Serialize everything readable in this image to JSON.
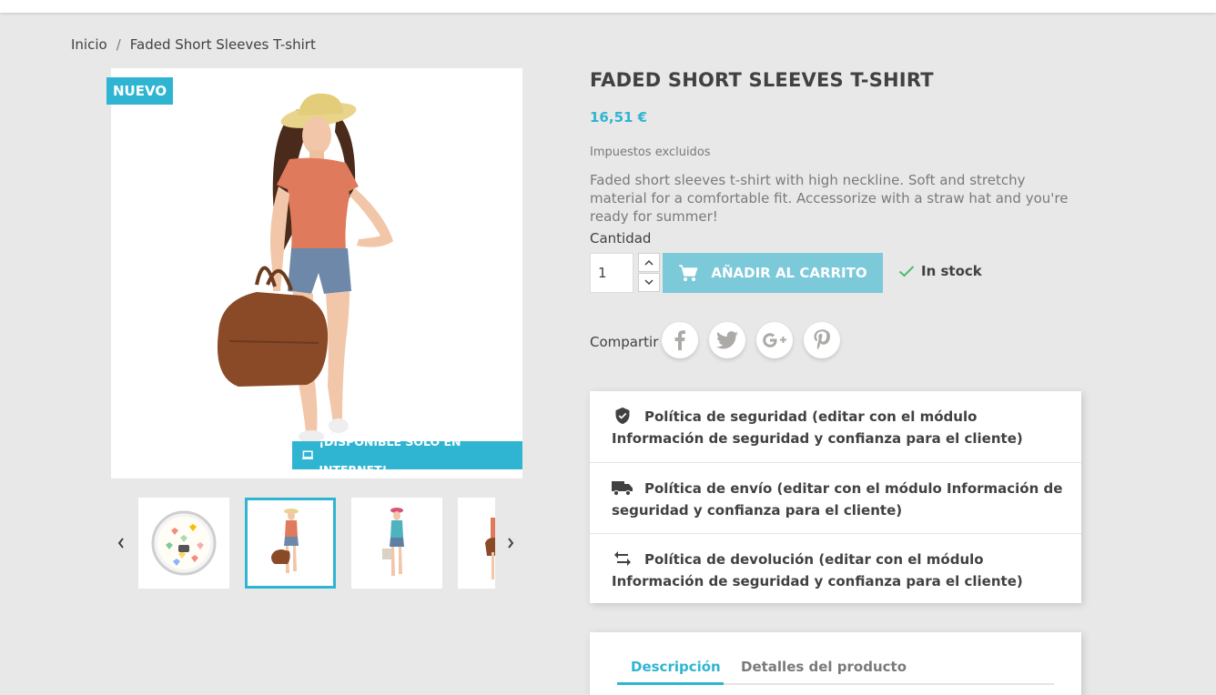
{
  "breadcrumb": {
    "home": "Inicio",
    "separator": "/",
    "current": "Faded Short Sleeves T-shirt"
  },
  "badges": {
    "new": "NUEVO",
    "online_only": "¡DISPONIBLE SÓLO EN INTERNET!"
  },
  "product": {
    "title": "FADED SHORT SLEEVES T-SHIRT",
    "price": "16,51 €",
    "tax_note": "Impuestos excluidos",
    "description": "Faded short sleeves t-shirt with high neckline. Soft and stretchy material for a comfortable fit. Accessorize with a straw hat and you're ready for summer!"
  },
  "quantity": {
    "label": "Cantidad",
    "value": "1"
  },
  "cart": {
    "add_label": "AÑADIR AL CARRITO"
  },
  "stock": {
    "label": "In stock"
  },
  "share": {
    "label": "Compartir",
    "networks": [
      "facebook",
      "twitter",
      "google-plus",
      "pinterest"
    ]
  },
  "reassurance": [
    {
      "icon": "shield-check-icon",
      "text": "Política de seguridad (editar con el módulo Información de seguridad y confianza para el cliente)"
    },
    {
      "icon": "truck-icon",
      "text": "Política de envío (editar con el módulo Información de seguridad y confianza para el cliente)"
    },
    {
      "icon": "swap-arrows-icon",
      "text": "Política de devolución (editar con el módulo Información de seguridad y confianza para el cliente)"
    }
  ],
  "tabs": [
    {
      "label": "Descripción",
      "active": true
    },
    {
      "label": "Detalles del producto",
      "active": false
    }
  ],
  "colors": {
    "accent": "#2fb5d2",
    "button": "#7bc9d9",
    "background": "#e8e8e8",
    "text": "#414141",
    "muted": "#7a7a7a",
    "stock_check": "#4cbb6c"
  }
}
